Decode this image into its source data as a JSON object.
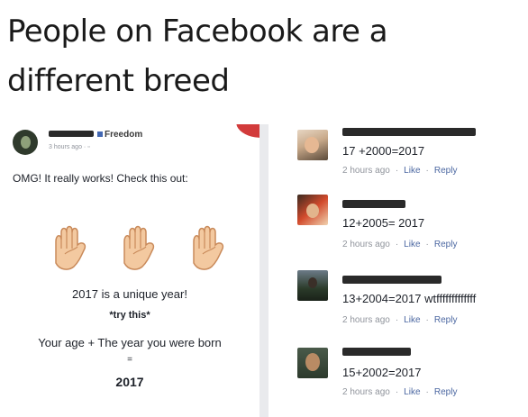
{
  "meme": {
    "title": "People on Facebook are a different breed"
  },
  "post": {
    "page_name": "Freedom",
    "timestamp": "3 hours ago",
    "intro": "OMG! It really works! Check this out:",
    "line_unique": "2017 is a unique year!",
    "line_try": "*try this*",
    "line_formula": "Your age + The year you were born",
    "line_equals": "=",
    "line_answer": "2017"
  },
  "comments": [
    {
      "text": "17 +2000=2017",
      "time": "2 hours ago",
      "like": "Like",
      "reply": "Reply"
    },
    {
      "text": "12+2005= 2017",
      "time": "2 hours ago",
      "like": "Like",
      "reply": "Reply"
    },
    {
      "text": "13+2004=2017 wtfffffffffffff",
      "time": "2 hours ago",
      "like": "Like",
      "reply": "Reply"
    },
    {
      "text": "15+2002=2017",
      "time": "2 hours ago",
      "like": "Like",
      "reply": "Reply"
    }
  ],
  "colors": {
    "link": "#4b67a1",
    "meta": "#90949c",
    "hand_fill": "#f3c9a0",
    "hand_stroke": "#c98a5a"
  },
  "icons": {
    "hand": "raised-fist-hand-icon"
  }
}
